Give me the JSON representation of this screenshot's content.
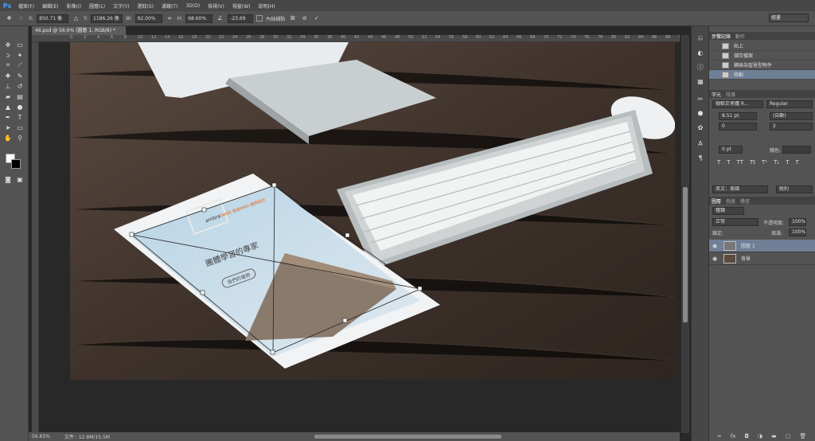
{
  "app": {
    "logo": "Ps"
  },
  "menu": [
    "檔案(F)",
    "編輯(E)",
    "影像(I)",
    "圖層(L)",
    "文字(Y)",
    "選取(S)",
    "濾鏡(T)",
    "3D(D)",
    "檢視(V)",
    "視窗(W)",
    "說明(H)"
  ],
  "options": {
    "x_label": "X:",
    "x_value": "850.71 像",
    "y_label": "Y:",
    "y_value": "1186.26 像",
    "w_label": "W:",
    "w_value": "92.00%",
    "h_label": "H:",
    "h_value": "68.60%",
    "angle_value": "-23.69",
    "interp_label": "內插補點",
    "workspace": "繪畫"
  },
  "document_tab": "46.psd @ 56.6% (圖層 1, RGB/8) *",
  "ruler_ticks": [
    "0",
    "2",
    "4",
    "6",
    "8",
    "10",
    "12",
    "14",
    "16",
    "18",
    "20",
    "22",
    "24",
    "26",
    "28",
    "30",
    "32",
    "34",
    "36",
    "38",
    "40",
    "42",
    "44",
    "46",
    "48",
    "50",
    "52",
    "54",
    "56",
    "58",
    "60",
    "62",
    "64",
    "66",
    "68",
    "70",
    "72",
    "74",
    "76",
    "78",
    "80",
    "82",
    "84",
    "86",
    "88",
    "90"
  ],
  "status": {
    "zoom": "56.65%",
    "doc": "文件：12.8M/15.5M"
  },
  "screen_site": {
    "brand_left": "ambra",
    "brand_right": "tweb",
    "brand_cn": "盈高RWD 網頁設計",
    "headline": "團體學習的專家",
    "button": "我們的優勢"
  },
  "history_panel": {
    "tabs": [
      "步驟記錄",
      "動作"
    ],
    "items": [
      "貼上",
      "儲存檔案",
      "轉換為智慧型物件",
      "移動"
    ]
  },
  "char_panel": {
    "tabs": [
      "字元",
      "段落"
    ],
    "font": "微軟正黑體 R...",
    "style": "Regular",
    "size": "8.51 pt",
    "leading": "(自動)",
    "tracking": "0",
    "kerning": "2",
    "scale_v": "0 pt",
    "color_label": "顏色:",
    "language": "英文：美國",
    "aa": "銳利"
  },
  "layers_panel": {
    "tabs": [
      "圖層",
      "色版",
      "路徑"
    ],
    "filter": "種類",
    "blend": "正常",
    "opacity_label": "不透明度:",
    "opacity": "100%",
    "lock_label": "鎖定:",
    "fill_label": "填滿:",
    "fill": "100%",
    "layers": [
      {
        "name": "圖層 1",
        "selected": true
      },
      {
        "name": "背景",
        "selected": false
      }
    ]
  }
}
